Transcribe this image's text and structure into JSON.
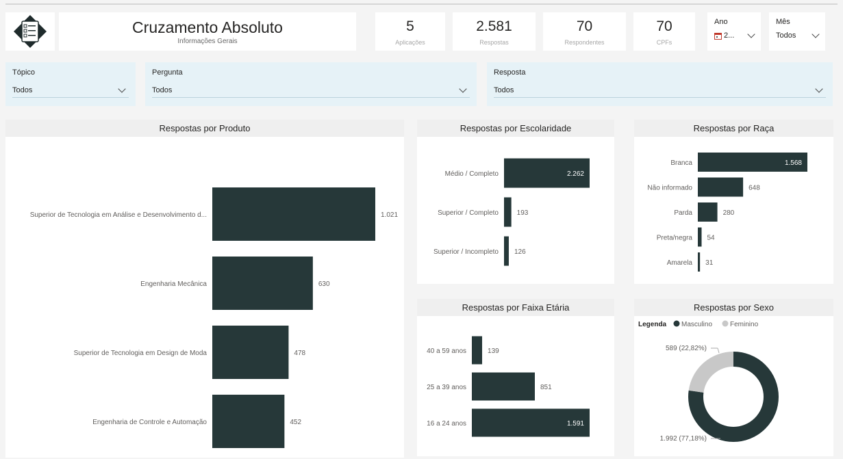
{
  "header": {
    "title": "Cruzamento Absoluto",
    "subtitle": "Informações Gerais"
  },
  "kpis": [
    {
      "value": "5",
      "label": "Aplicações"
    },
    {
      "value": "2.581",
      "label": "Respostas"
    },
    {
      "value": "70",
      "label": "Respondentes"
    },
    {
      "value": "70",
      "label": "CPFs"
    }
  ],
  "slicers": {
    "ano": {
      "label": "Ano",
      "value": "2..."
    },
    "mes": {
      "label": "Mês",
      "value": "Todos"
    }
  },
  "filters": {
    "topico": {
      "label": "Tópico",
      "value": "Todos"
    },
    "pergunta": {
      "label": "Pergunta",
      "value": "Todos"
    },
    "resposta": {
      "label": "Resposta",
      "value": "Todos"
    }
  },
  "colors": {
    "bar": "#263839",
    "secondary": "#c8c8c8",
    "label_dark": "#605e5c",
    "label_light": "#ffffff"
  },
  "icons": {
    "logo": "questionnaire-icon",
    "ano_picker": "calendar-icon",
    "dropdown": "chevron-down-icon"
  },
  "chart_data": [
    {
      "type": "bar",
      "orientation": "horizontal",
      "title": "Respostas por Produto",
      "categories": [
        "Superior de Tecnologia em Análise e Desenvolvimento d...",
        "Engenharia Mecânica",
        "Superior de Tecnologia em Design de Moda",
        "Engenharia de Controle e Automação"
      ],
      "values": [
        1021,
        630,
        478,
        452
      ],
      "value_labels": [
        "1.021",
        "630",
        "478",
        "452"
      ]
    },
    {
      "type": "bar",
      "orientation": "horizontal",
      "title": "Respostas por Escolaridade",
      "categories": [
        "Médio / Completo",
        "Superior / Completo",
        "Superior / Incompleto"
      ],
      "values": [
        2262,
        193,
        126
      ],
      "value_labels": [
        "2.262",
        "193",
        "126"
      ]
    },
    {
      "type": "bar",
      "orientation": "horizontal",
      "title": "Respostas por Raça",
      "categories": [
        "Branca",
        "Não informado",
        "Parda",
        "Preta/negra",
        "Amarela"
      ],
      "values": [
        1568,
        648,
        280,
        54,
        31
      ],
      "value_labels": [
        "1.568",
        "648",
        "280",
        "54",
        "31"
      ]
    },
    {
      "type": "bar",
      "orientation": "horizontal",
      "title": "Respostas por Faixa Etária",
      "categories": [
        "40 a 59 anos",
        "25 a 39 anos",
        "16 a 24 anos"
      ],
      "values": [
        139,
        851,
        1591
      ],
      "value_labels": [
        "139",
        "851",
        "1.591"
      ]
    },
    {
      "type": "pie",
      "variant": "donut",
      "title": "Respostas por Sexo",
      "legend_title": "Legenda",
      "legend_position": "top-left",
      "categories": [
        "Masculino",
        "Feminino"
      ],
      "values": [
        1992,
        589
      ],
      "value_labels": [
        "1.992 (77,18%)",
        "589 (22,82%)"
      ]
    }
  ]
}
